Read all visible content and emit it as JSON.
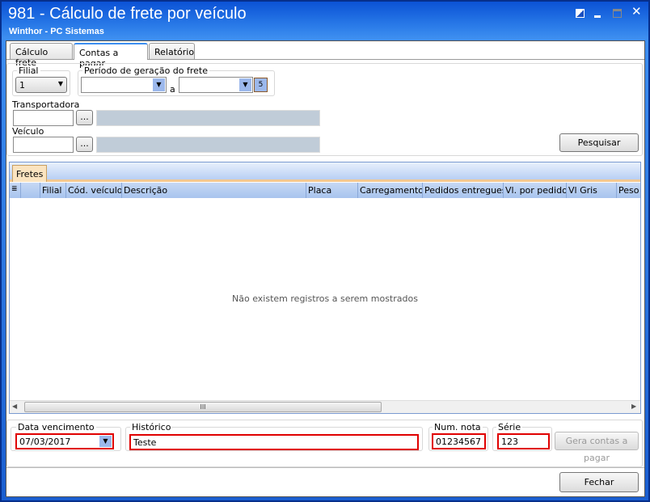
{
  "window": {
    "title": "981 - Cálculo de frete por veículo",
    "subtitle": "Winthor - PC Sistemas",
    "icons": [
      "restore-icon",
      "minimize-icon",
      "maximize-icon",
      "close-icon"
    ]
  },
  "tabs": [
    {
      "label": "Cálculo frete"
    },
    {
      "label": "Contas a pagar",
      "active": true
    },
    {
      "label": "Relatório"
    }
  ],
  "filters": {
    "filial_label": "Filial",
    "filial_value": "1",
    "periodo_label": "Período de geração do frete",
    "periodo_sep": "a",
    "periodo_from": "",
    "periodo_to": "",
    "transportadora_label": "Transportadora",
    "transportadora_value": "",
    "veiculo_label": "Veículo",
    "veiculo_value": "",
    "ellipsis": "...",
    "pesquisar": "Pesquisar"
  },
  "grid": {
    "tab": "Fretes",
    "columns": [
      "Filial",
      "Cód. veículo",
      "Descrição",
      "Placa",
      "Carregamento",
      "Pedidos entregues",
      "Vl. por pedido",
      "Vl Gris",
      "Peso"
    ],
    "empty_message": "Não existem registros a serem mostrados",
    "scroll_grip": "III"
  },
  "bottom": {
    "data_venc_label": "Data vencimento",
    "data_venc_value": "07/03/2017",
    "historico_label": "Histórico",
    "historico_value": "Teste",
    "num_nota_label": "Num. nota",
    "num_nota_value": "01234567",
    "serie_label": "Série",
    "serie_value": "123",
    "gera_button": "Gera contas a pagar"
  },
  "footer": {
    "fechar": "Fechar"
  }
}
